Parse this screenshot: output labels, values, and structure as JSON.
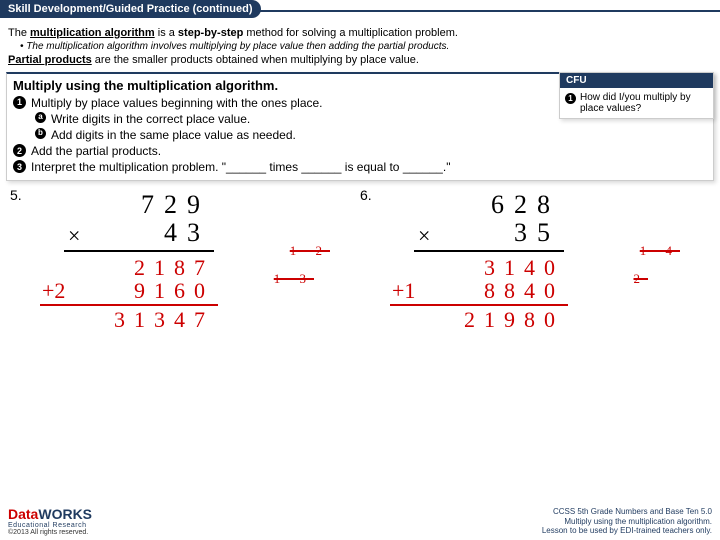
{
  "header": "Skill Development/Guided Practice (continued)",
  "intro": {
    "l1a": "The ",
    "l1b": "multiplication algorithm",
    "l1c": " is a ",
    "l1d": "step-by-step",
    "l1e": " method for solving a multiplication problem.",
    "l2": "The multiplication algorithm involves multiplying by place value then adding the partial products.",
    "l3a": "Partial products",
    "l3b": " are the smaller products obtained when multiplying by place value."
  },
  "steps": {
    "title": "Multiply using the multiplication algorithm.",
    "s1": "Multiply by place values beginning with the ones place.",
    "s1a": "Write digits in the correct place value.",
    "s1b": "Add digits in the same place value as needed.",
    "s2": "Add the partial products.",
    "s3": "Interpret the multiplication problem. \"______ times ______ is equal to ______.\""
  },
  "cfu": {
    "header": "CFU",
    "q1": "How did I/you multiply by place values?"
  },
  "problems": {
    "p5": {
      "num": "5.",
      "top": "729",
      "bot": "43",
      "carry1": "1 2",
      "pp1": "2187",
      "carry2": "1 3",
      "pp2a": "+2",
      "pp2b": "9160",
      "ans": "31347"
    },
    "p6": {
      "num": "6.",
      "top": "628",
      "bot": "35",
      "carry1": "1 4",
      "pp1": "3140",
      "carry2": "2",
      "pp2a": "+1",
      "pp2b": "8840",
      "ans": "21980"
    }
  },
  "footer": {
    "logo1": "Data",
    "logo2": "WORKS",
    "logosub": "Educational Research",
    "copy": "©2013 All rights reserved.",
    "r1": "CCSS 5th Grade Numbers and Base Ten 5.0",
    "r2": "Multiply using the multiplication algorithm.",
    "r3": "Lesson to be used by EDI-trained teachers only."
  }
}
